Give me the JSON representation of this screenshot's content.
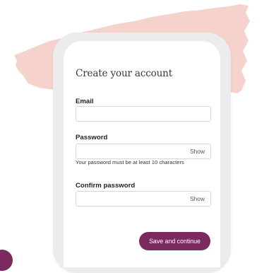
{
  "form": {
    "title": "Create your account",
    "email_label": "Email",
    "email_value": "",
    "password_label": "Password",
    "password_value": "",
    "password_show": "Show",
    "password_hint": "Your password must be at least 10 characters",
    "confirm_label": "Confirm password",
    "confirm_value": "",
    "confirm_show": "Show",
    "submit_label": "Save and continue"
  },
  "colors": {
    "accent": "#7a2a5e",
    "paper": "#f6d3cc",
    "phone_frame": "#ececee"
  }
}
